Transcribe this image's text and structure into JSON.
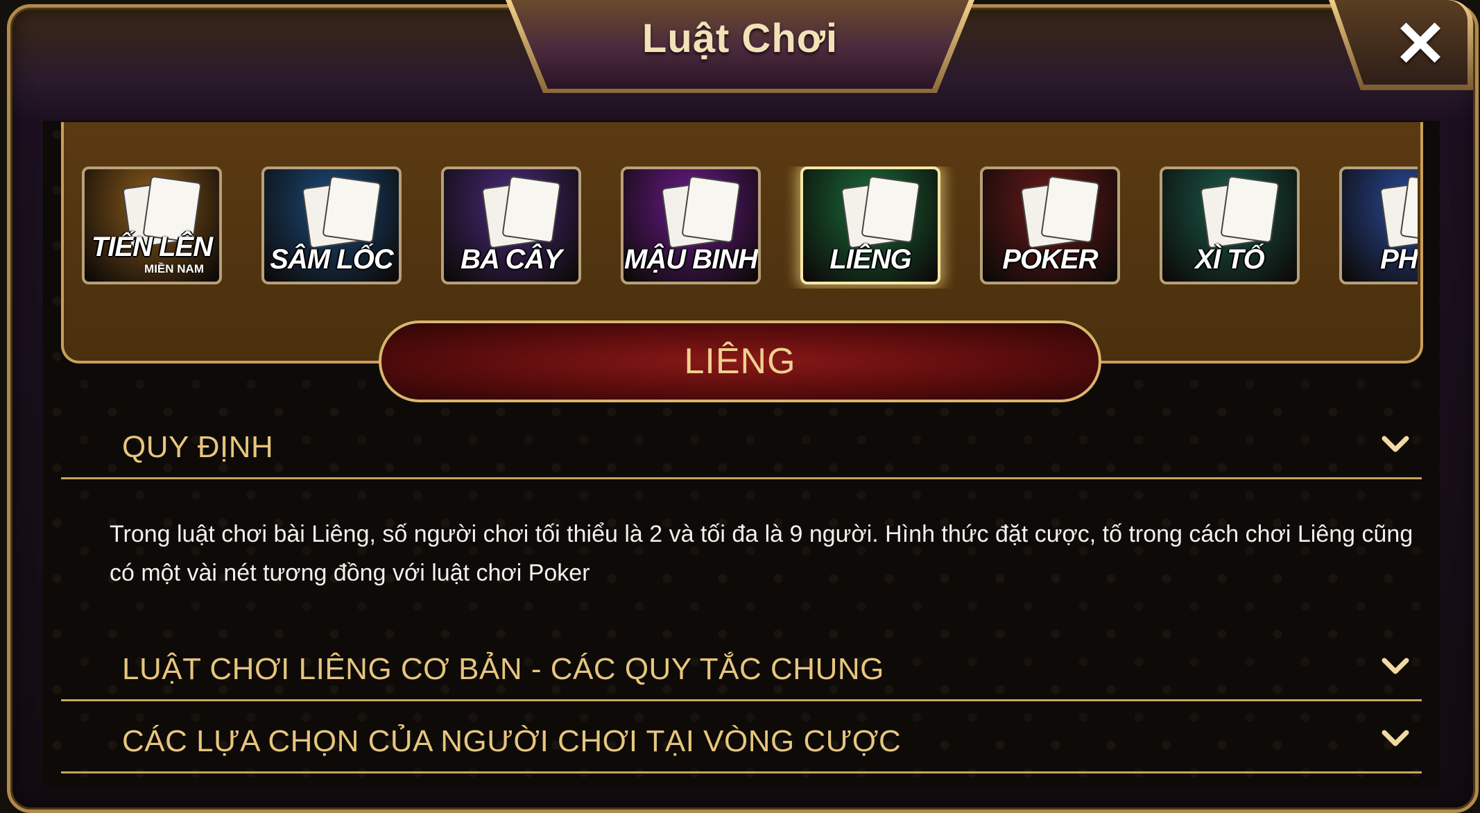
{
  "header": {
    "title": "Luật Chơi",
    "close_icon": "close-icon"
  },
  "games": [
    {
      "label": "TIẾN LÊN",
      "sub": "MIỀN NAM",
      "color": "#8a5a1a"
    },
    {
      "label": "SÂM LỐC",
      "sub": "",
      "color": "#1a4a7a"
    },
    {
      "label": "BA CÂY",
      "sub": "",
      "color": "#4a2a7a"
    },
    {
      "label": "MẬU BINH",
      "sub": "",
      "color": "#6a1a8a"
    },
    {
      "label": "LIÊNG",
      "sub": "",
      "color": "#1a6a3a",
      "selected": true
    },
    {
      "label": "POKER",
      "sub": "",
      "color": "#6a1a1a"
    },
    {
      "label": "XÌ TỐ",
      "sub": "",
      "color": "#1a5a4a"
    },
    {
      "label": "PHỎ",
      "sub": "",
      "color": "#2a4a9a"
    }
  ],
  "selected_game": {
    "title": "LIÊNG"
  },
  "sections": [
    {
      "title": "QUY ĐỊNH",
      "expanded": true,
      "content": "Trong luật chơi bài Liêng, số người chơi tối thiểu là 2 và tối đa là 9 người. Hình thức đặt cược, tố trong cách chơi Liêng cũng có một vài nét tương đồng với luật chơi Poker"
    },
    {
      "title": "LUẬT CHƠI LIÊNG CƠ BẢN - CÁC QUY TẮC CHUNG",
      "expanded": false
    },
    {
      "title": "CÁC LỰA CHỌN CỦA NGƯỜI CHƠI TẠI VÒNG CƯỢC",
      "expanded": false
    }
  ],
  "colors": {
    "gold": "#e6c67e",
    "frame_border": "#b08a4e",
    "banner_red": "#7a1212"
  }
}
